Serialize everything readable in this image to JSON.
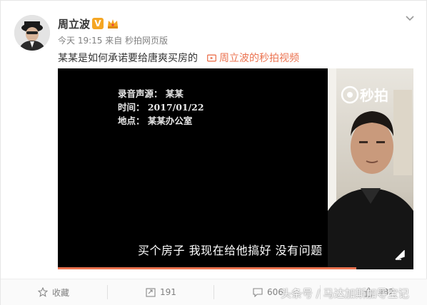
{
  "post": {
    "author": "周立波",
    "verified_badge": "V",
    "meta": "今天 19:15 来自 秒拍网页版",
    "text": "某某是如何承诺要给唐爽买房的",
    "video_link": "周立波的秒拍视频",
    "accent_color": "#eb7350"
  },
  "video": {
    "overlay": {
      "source": "录音声源：  某某",
      "time": "时间：  2017/01/22",
      "place": "地点：  某某办公室"
    },
    "subtitle": "买个房子  我现在给他搞好  没有问题",
    "watermark": "秒拍",
    "progress_fraction": 0.84
  },
  "actions": {
    "favorite_label": "收藏",
    "repost_count": "191",
    "comment_count": "606",
    "like_count": "982"
  },
  "overlay_watermark": "头条号 / 马达加斯加导宝记",
  "icons": [
    "avatar",
    "crown-icon",
    "chevron-down-icon",
    "video-link-icon",
    "watermark-logo-icon",
    "fullscreen-icon",
    "star-icon",
    "repost-icon",
    "comment-icon",
    "like-icon"
  ]
}
